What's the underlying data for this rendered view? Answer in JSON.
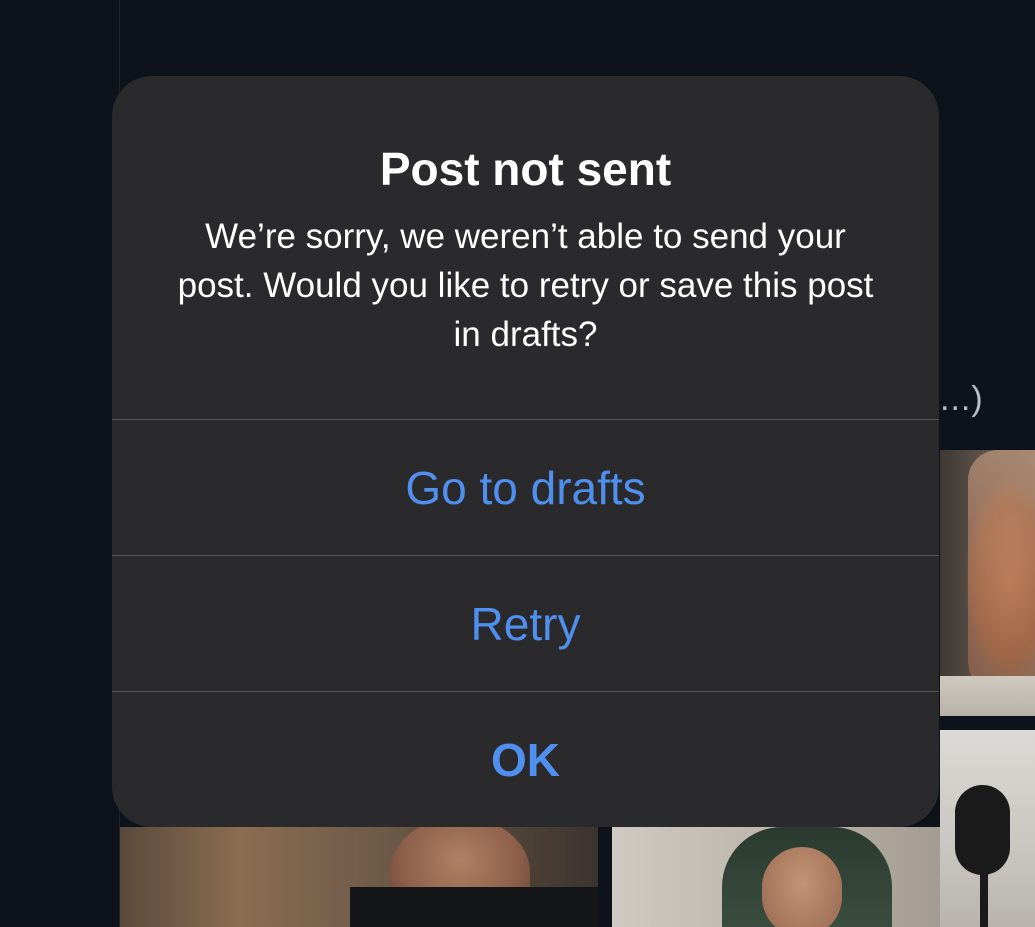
{
  "background": {
    "tweet_text_fragment": "...)"
  },
  "alert": {
    "title": "Post not sent",
    "message": "We’re sorry, we weren’t able to send your post. Would you like to retry or save this post in drafts?",
    "buttons": [
      {
        "label": "Go to drafts",
        "style": "default"
      },
      {
        "label": "Retry",
        "style": "default"
      },
      {
        "label": "OK",
        "style": "preferred"
      }
    ],
    "accent_color": "#4f8ff0"
  }
}
